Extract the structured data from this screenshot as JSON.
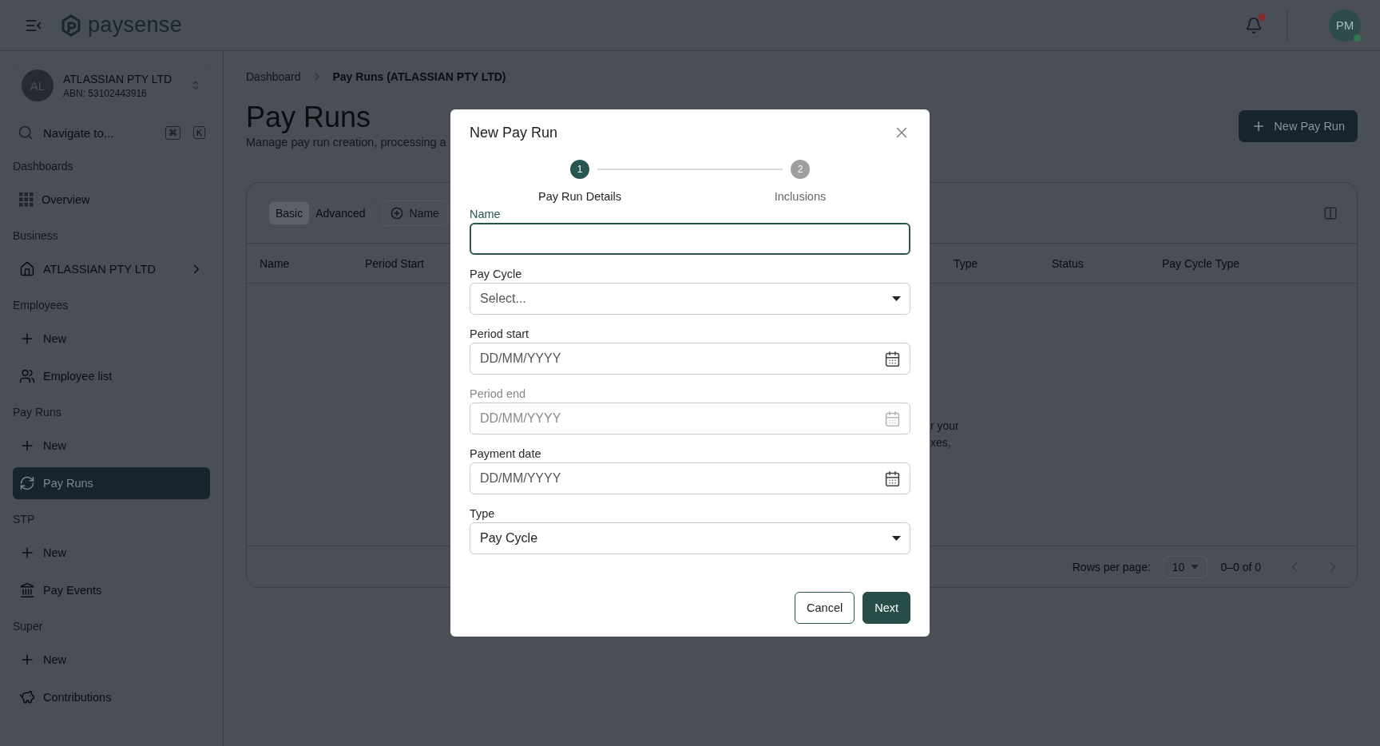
{
  "header": {
    "logo_text": "paysense",
    "notifications": {
      "unread": true
    },
    "avatar": {
      "initials": "PM",
      "online": true
    }
  },
  "sidebar": {
    "company": {
      "initials": "AL",
      "name": "ATLASSIAN PTY LTD",
      "abn": "ABN: 53102443916"
    },
    "search": {
      "placeholder": "Navigate to...",
      "shortcut_keys": [
        "⌘",
        "K"
      ]
    },
    "sections": [
      {
        "title": "Dashboards",
        "items": [
          {
            "kind": "overview",
            "label": "Overview",
            "selected": false
          }
        ]
      },
      {
        "title": "Business",
        "items": [
          {
            "kind": "business",
            "label": "ATLASSIAN PTY LTD",
            "selected": false,
            "has_submenu": true
          }
        ]
      },
      {
        "title": "Employees",
        "items": [
          {
            "kind": "new",
            "label": "New",
            "selected": false
          },
          {
            "kind": "employees",
            "label": "Employee list",
            "selected": false
          }
        ]
      },
      {
        "title": "Pay Runs",
        "items": [
          {
            "kind": "new",
            "label": "New",
            "selected": false
          },
          {
            "kind": "payruns",
            "label": "Pay Runs",
            "selected": true
          }
        ]
      },
      {
        "title": "STP",
        "items": [
          {
            "kind": "new",
            "label": "New",
            "selected": false
          },
          {
            "kind": "events",
            "label": "Pay Events",
            "selected": false
          }
        ]
      },
      {
        "title": "Super",
        "items": [
          {
            "kind": "new",
            "label": "New",
            "selected": false
          },
          {
            "kind": "contributions",
            "label": "Contributions",
            "selected": false
          }
        ]
      }
    ]
  },
  "breadcrumb": [
    "Dashboard",
    "Pay Runs (ATLASSIAN PTY LTD)"
  ],
  "page": {
    "title": "Pay Runs",
    "subtitle": "Manage pay run creation, processing a",
    "new_button": "New Pay Run"
  },
  "table": {
    "modes": [
      {
        "label": "Basic",
        "selected": true
      },
      {
        "label": "Advanced",
        "selected": false
      }
    ],
    "filters": [
      "Name"
    ],
    "columns": [
      "Name",
      "Period Start",
      "Type",
      "Status",
      "Pay Cycle Type"
    ],
    "empty_text_lines": [
      "r your",
      "xes,"
    ],
    "footer": {
      "rows_per_page_label": "Rows per page:",
      "rows_per_page": "10",
      "range": "0–0 of 0"
    }
  },
  "dialog": {
    "title": "New Pay Run",
    "steps": [
      {
        "number": "1",
        "label": "Pay Run Details",
        "selected": true
      },
      {
        "number": "2",
        "label": "Inclusions",
        "selected": false
      }
    ],
    "fields": [
      {
        "kind": "text",
        "label": "Name",
        "focused": true,
        "disabled": false
      },
      {
        "kind": "select",
        "label": "Pay Cycle",
        "placeholder": "Select...",
        "focused": false,
        "disabled": false
      },
      {
        "kind": "date",
        "label": "Period start",
        "placeholder": "DD/MM/YYYY",
        "focused": false,
        "disabled": false
      },
      {
        "kind": "date",
        "label": "Period end",
        "placeholder": "DD/MM/YYYY",
        "focused": false,
        "disabled": true
      },
      {
        "kind": "date",
        "label": "Payment date",
        "placeholder": "DD/MM/YYYY",
        "focused": false,
        "disabled": false
      },
      {
        "kind": "select",
        "label": "Type",
        "value": "Pay Cycle",
        "focused": false,
        "disabled": false
      }
    ],
    "buttons": [
      {
        "kind": "secondary",
        "label": "Cancel"
      },
      {
        "kind": "primary",
        "label": "Next"
      }
    ]
  }
}
